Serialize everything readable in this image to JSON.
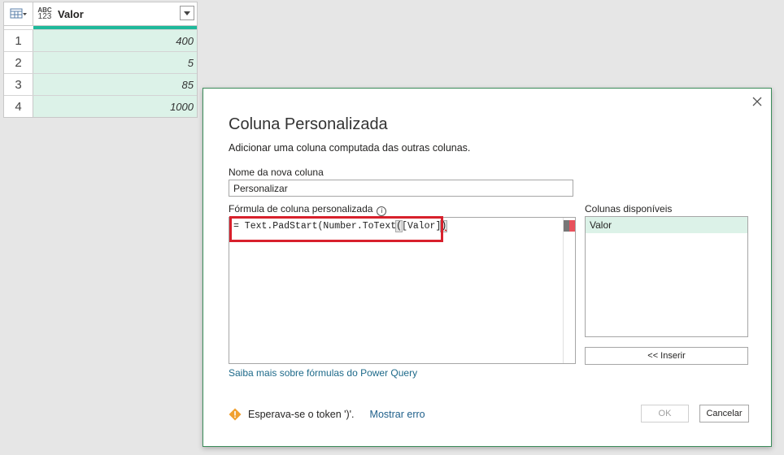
{
  "grid": {
    "column": {
      "type_top": "ABC",
      "type_bottom": "123",
      "name": "Valor"
    },
    "rows": [
      {
        "num": "1",
        "value": "400"
      },
      {
        "num": "2",
        "value": "5"
      },
      {
        "num": "3",
        "value": "85"
      },
      {
        "num": "4",
        "value": "1000"
      }
    ]
  },
  "dialog": {
    "title": "Coluna Personalizada",
    "subtitle": "Adicionar uma coluna computada das outras colunas.",
    "name_label": "Nome da nova coluna",
    "name_value": "Personalizar",
    "formula_label": "Fórmula de coluna personalizada",
    "info_glyph": "i",
    "formula": {
      "prefix": "= Text.PadStart(Number.ToText",
      "paren": "(",
      "middle": "[Valor]",
      "close": ")"
    },
    "available_label": "Colunas disponíveis",
    "available_columns": [
      "Valor"
    ],
    "insert_label": "<< Inserir",
    "learn_more": "Saiba mais sobre fórmulas do Power Query",
    "warning_text": "Esperava-se o token ')'.",
    "show_error": "Mostrar erro",
    "ok_label": "OK",
    "cancel_label": "Cancelar"
  },
  "colors": {
    "quality_bar": "#1fb99b",
    "row_fill": "#dcf2e8",
    "highlight_rect": "#d8202c",
    "warning": "#f0a030",
    "link": "#1e6a8a"
  }
}
